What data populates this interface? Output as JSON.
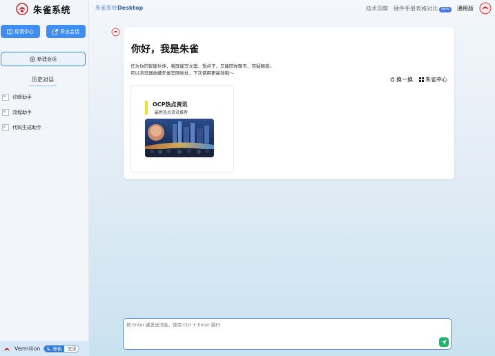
{
  "app": {
    "name": "朱雀系统"
  },
  "sidebar": {
    "feedback_label": "反馈中心",
    "export_label": "导出会话",
    "new_chat_label": "新建会话",
    "history_title": "历史对话",
    "history": [
      {
        "label": "诊断助手"
      },
      {
        "label": "流程助手"
      },
      {
        "label": "代码生成助手"
      }
    ],
    "footer": {
      "name": "Vermilion",
      "mode_on": "亮色",
      "mode_off": "沉浸"
    }
  },
  "topbar": {
    "title_prefix": "朱雀系统",
    "title_suffix": "Desktop",
    "links": {
      "tech": "技术洞察",
      "hardware": "硬件手册表格对比",
      "badge": "NEW",
      "edition": "通用版"
    }
  },
  "welcome": {
    "greeting": "你好，我是朱雀",
    "intro_line1": "作为你的智能伙伴，我既能写文案、想点子，又能陪你聊天、答疑解惑。",
    "intro_line2": "可以浏览器收藏朱雀官网地址，下次使用更高效哦～",
    "refresh_label": "换一换",
    "center_label": "朱雀中心",
    "feature": {
      "title": "OCP热点资讯",
      "subtitle": "最新热点资讯推荐"
    }
  },
  "input": {
    "placeholder": "按 Enter 键发送消息，使用 Ctrl + Enter 换行"
  },
  "colors": {
    "accent": "#3f8ef7",
    "send": "#1fb36b",
    "highlight": "#e6e620"
  }
}
